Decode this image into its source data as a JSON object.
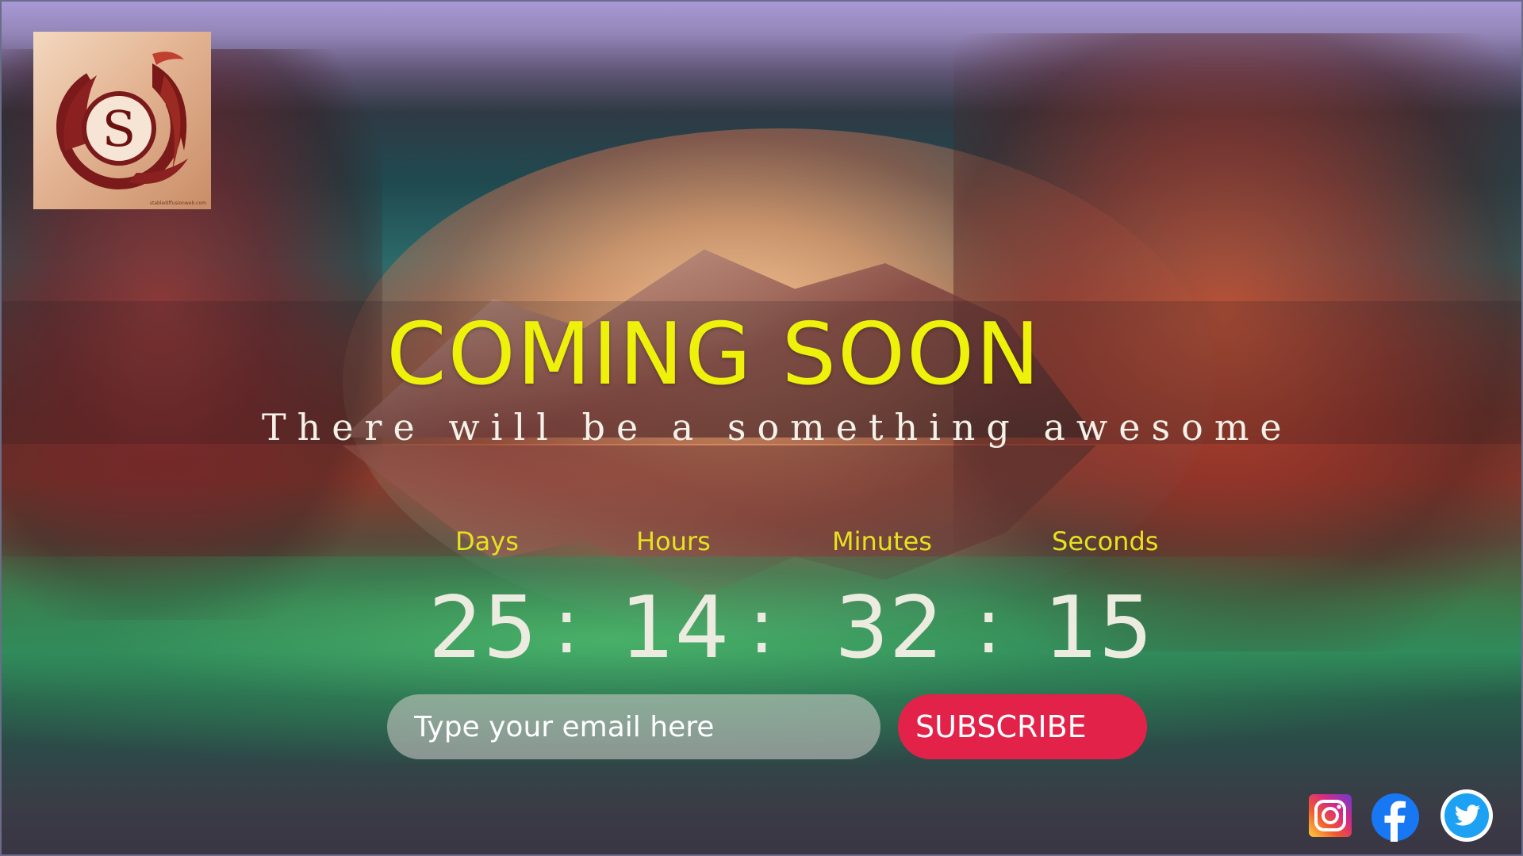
{
  "brand": {
    "logo_letter": "S",
    "logo_fineprint": "stablediffusionweb.com"
  },
  "hero": {
    "headline": "COMING SOON",
    "subline": "There will be a something awesome"
  },
  "countdown": {
    "labels": {
      "days": "Days",
      "hours": "Hours",
      "minutes": "Minutes",
      "seconds": "Seconds"
    },
    "values": {
      "days": "25",
      "hours": "14",
      "minutes": "32",
      "seconds": "15"
    },
    "separator": ":"
  },
  "subscribe": {
    "email_placeholder": "Type your email here",
    "button_label": "SUBSCRIBE"
  },
  "social": {
    "icons": [
      "instagram-icon",
      "facebook-icon",
      "twitter-icon"
    ]
  },
  "colors": {
    "headline": "#eef20a",
    "countdown_label": "#e6e220",
    "button": "#e3224a",
    "top_band": "#a899d6"
  }
}
